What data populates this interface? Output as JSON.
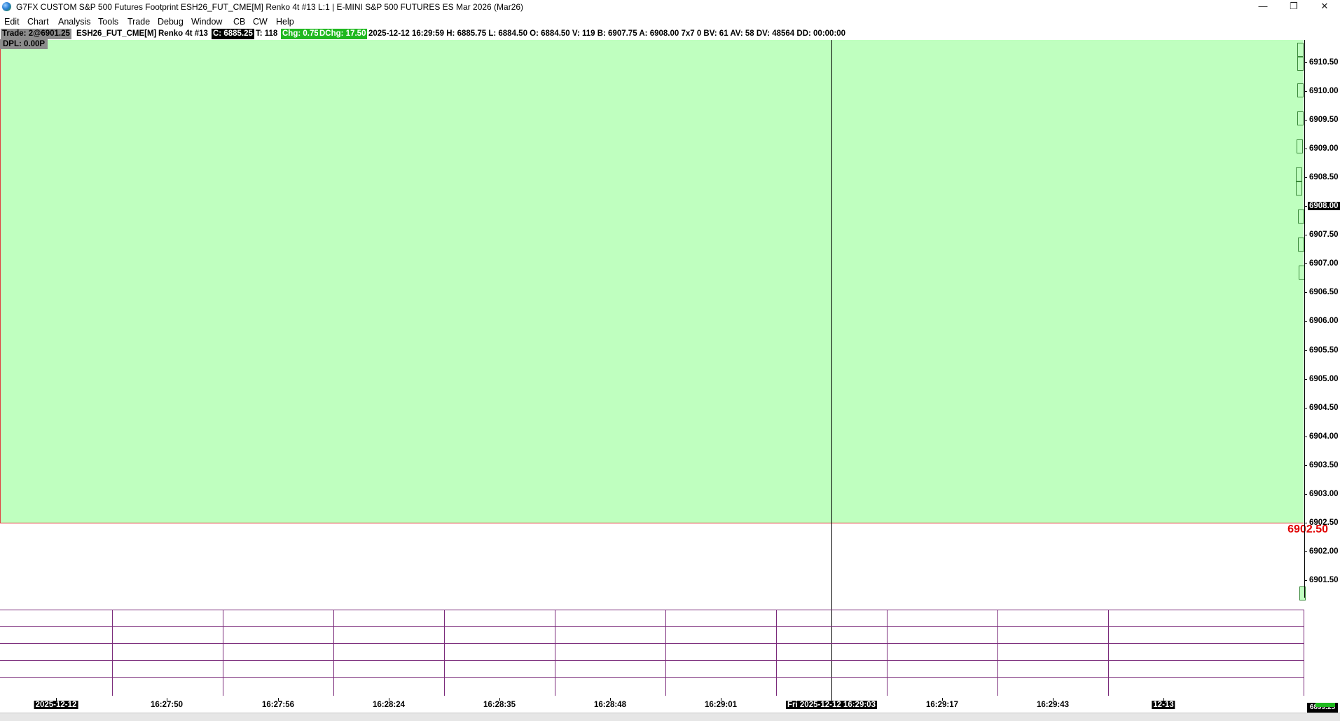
{
  "window": {
    "title": "G7FX CUSTOM S&P 500 Futures Footprint ESH26_FUT_CME[M]  Renko 4t #13 L:1 | E-MINI S&P 500 FUTURES ES Mar 2026 (Mar26)",
    "minimize": "—",
    "maximize": "❐",
    "close": "✕"
  },
  "menu": [
    "Edit",
    "Chart",
    "Analysis",
    "Tools",
    "Trade",
    "Debug",
    "Window",
    "CB",
    "CW",
    "Help"
  ],
  "info": {
    "trade": "Trade: 2@6901.25",
    "symbol": "ESH26_FUT_CME[M]",
    "chart": "Renko 4t #13",
    "close": "C: 6885.25",
    "ticks": "T: 118",
    "chg": "Chg: 0.75",
    "dchg": "DChg: 17.50",
    "stats": "2025-12-12 16:29:59 H: 6885.75 L: 6884.50 O: 6884.50 V: 119 B: 6907.75 A: 6908.00 7x7 0 BV: 61 AV: 58 DV: 48564 DD: 00:00:00",
    "dpl": "DPL: 0.00P"
  },
  "colors": {
    "chart_bg": "#bfffbf",
    "line_red": "#e03030",
    "grid_purple": "#7a2a7a",
    "chip_green": "#1fb81f"
  },
  "chart": {
    "red_line_price": "6902.50",
    "current_price": "6908.00",
    "y_ticks": [
      "6910.50",
      "6910.00",
      "6909.50",
      "6909.00",
      "6908.50",
      "6908.00",
      "6907.50",
      "6907.00",
      "6906.50",
      "6906.00",
      "6905.50",
      "6905.00",
      "6904.50",
      "6904.00",
      "6903.50",
      "6903.00",
      "6902.50",
      "6902.00",
      "6901.50"
    ],
    "x_labels": [
      "2025-12-12",
      "16:27:50",
      "16:27:56",
      "16:28:24",
      "16:28:35",
      "16:28:48",
      "16:29:01",
      "Fri 2025-12-12  16:29:03",
      "16:29:17",
      "16:29:43",
      "12-13"
    ],
    "corner_label": "6899.25"
  }
}
